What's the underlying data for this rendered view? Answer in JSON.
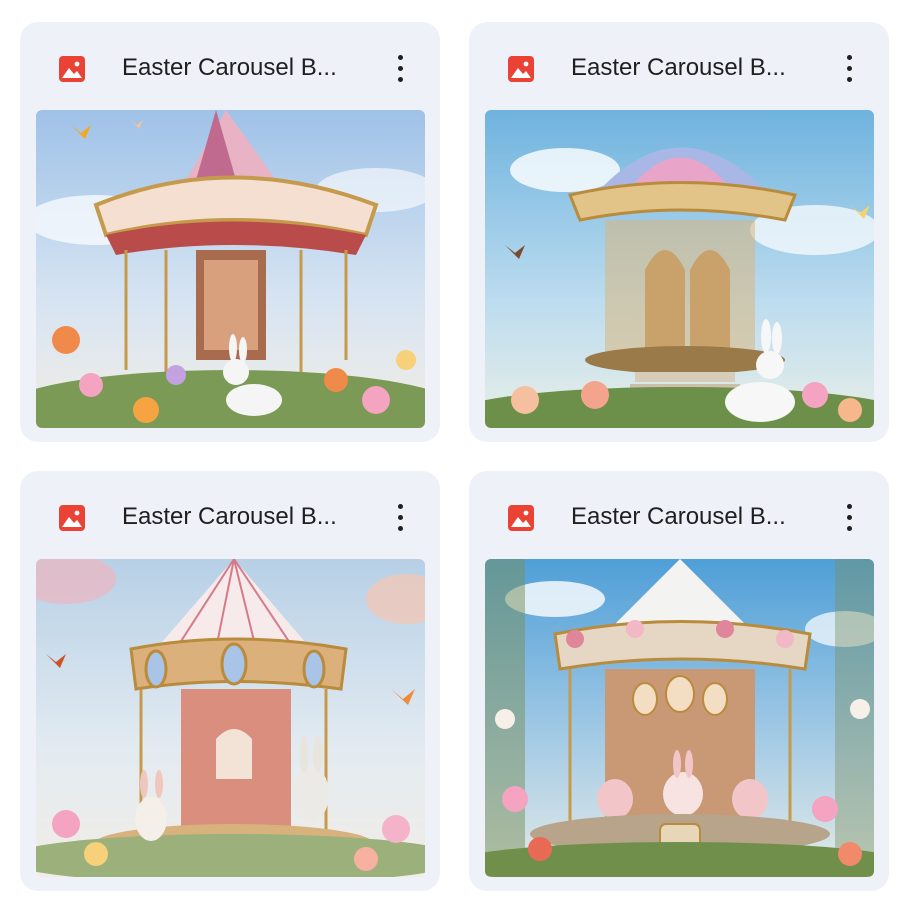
{
  "files": [
    {
      "title": "Easter Carousel B...",
      "icon": "image-file-icon",
      "thumbnail": "easter-carousel-thumbnail"
    },
    {
      "title": "Easter Carousel B...",
      "icon": "image-file-icon",
      "thumbnail": "easter-carousel-thumbnail"
    },
    {
      "title": "Easter Carousel B...",
      "icon": "image-file-icon",
      "thumbnail": "easter-carousel-thumbnail"
    },
    {
      "title": "Easter Carousel B...",
      "icon": "image-file-icon",
      "thumbnail": "easter-carousel-thumbnail"
    }
  ],
  "colors": {
    "card_bg": "#eef1f7",
    "icon_red": "#ea4335",
    "text": "#1f1f1f"
  }
}
